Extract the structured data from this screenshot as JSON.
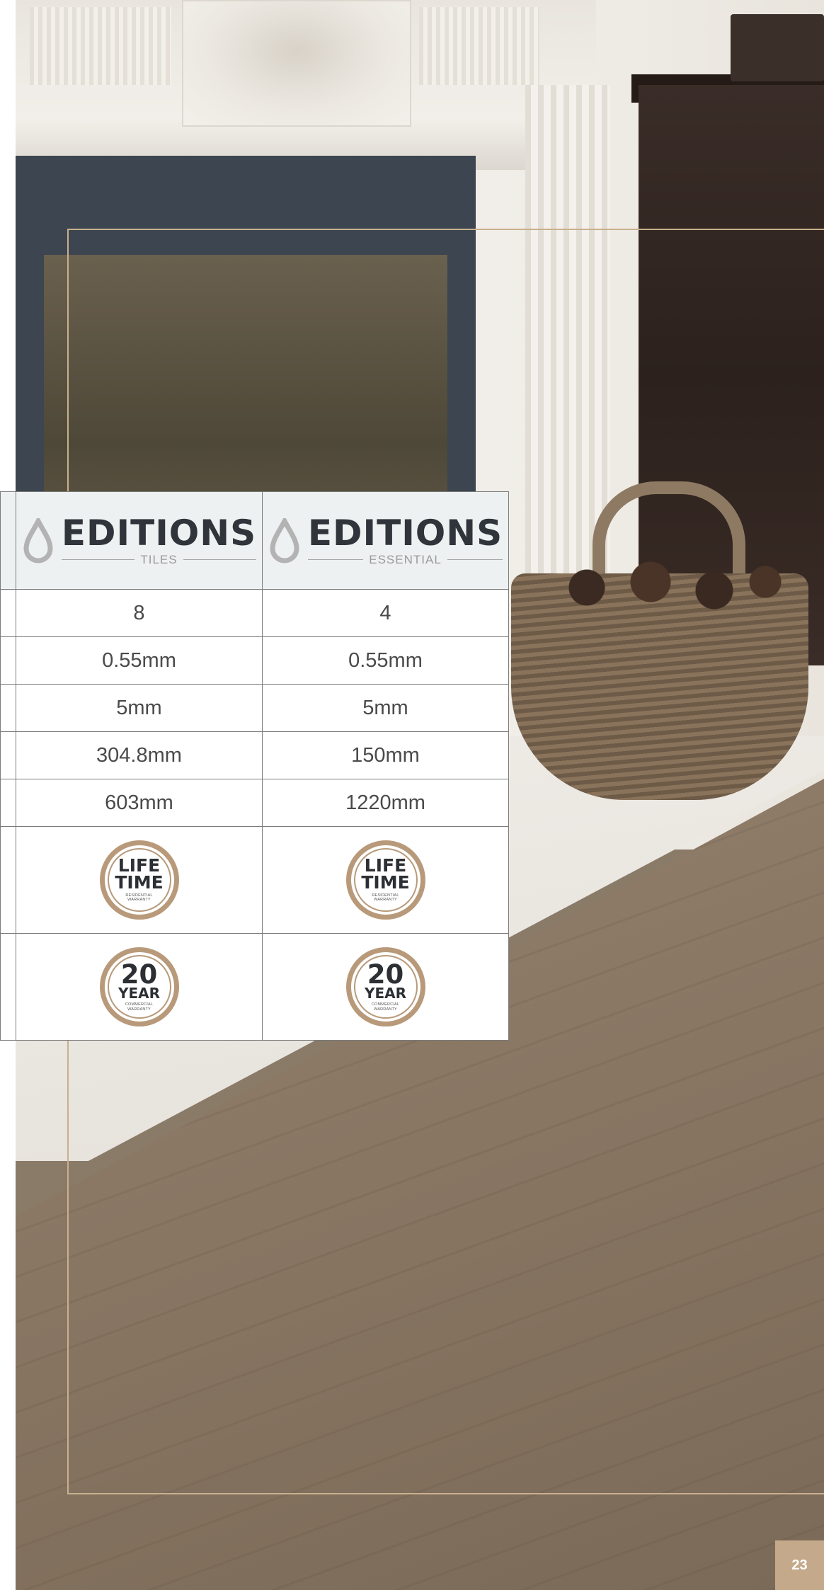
{
  "table": {
    "columns": [
      {
        "brand": "EDITIONS",
        "subtitle": "TILES"
      },
      {
        "brand": "EDITIONS",
        "subtitle": "ESSENTIAL"
      }
    ],
    "rows": [
      {
        "values": [
          "8",
          "4"
        ]
      },
      {
        "values": [
          "0.55mm",
          "0.55mm"
        ]
      },
      {
        "values": [
          "5mm",
          "5mm"
        ]
      },
      {
        "values": [
          "304.8mm",
          "150mm"
        ]
      },
      {
        "values": [
          "603mm",
          "1220mm"
        ]
      }
    ],
    "badges": {
      "residential": {
        "line1": "LIFE",
        "line2": "TIME",
        "small1": "RESIDENTIAL",
        "small2": "WARRANTY"
      },
      "commercial": {
        "line1": "20",
        "line2": "YEAR",
        "small1": "COMMERCIAL",
        "small2": "WARRANTY"
      }
    }
  },
  "page_number": "23",
  "colors": {
    "accent_gold": "#c4aa8a",
    "badge_ring": "#b89a7a",
    "header_bg": "#eef1f1",
    "brand_text": "#2f353a"
  },
  "icons": [
    "water-drop-icon"
  ]
}
